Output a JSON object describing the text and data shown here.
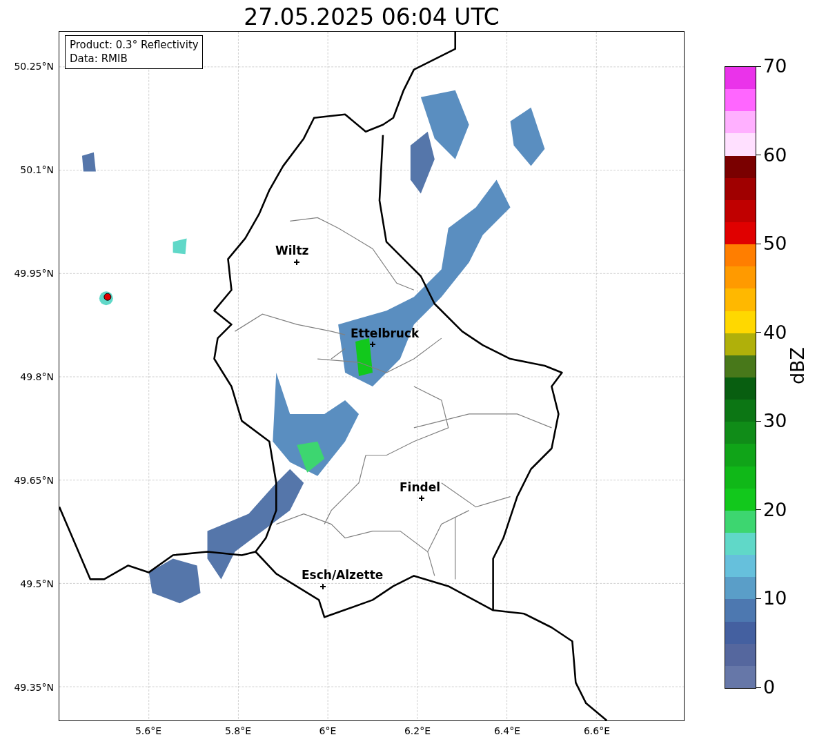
{
  "title": "27.05.2025 06:04 UTC",
  "info_box": [
    "Product: 0.3° Reflectivity",
    "Data: RMIB"
  ],
  "cities": [
    {
      "name": "Wiltz"
    },
    {
      "name": "Ettelbruck"
    },
    {
      "name": "Findel"
    },
    {
      "name": "Esch/Alzette"
    }
  ],
  "y_axis": {
    "ticks": [
      "50.25°N",
      "50.1°N",
      "49.95°N",
      "49.8°N",
      "49.65°N",
      "49.5°N",
      "49.35°N"
    ]
  },
  "x_axis": {
    "ticks": [
      "5.6°E",
      "5.8°E",
      "6°E",
      "6.2°E",
      "6.4°E",
      "6.6°E"
    ]
  },
  "colorbar": {
    "label": "dBZ",
    "ticks": [
      "70",
      "60",
      "50",
      "40",
      "30",
      "20",
      "10",
      "0"
    ],
    "bins": [
      {
        "color": "#ea33ea"
      },
      {
        "color": "#ff66ff"
      },
      {
        "color": "#ffb0ff"
      },
      {
        "color": "#ffe0ff"
      },
      {
        "color": "#7a0000"
      },
      {
        "color": "#a00000"
      },
      {
        "color": "#c00000"
      },
      {
        "color": "#e00000"
      },
      {
        "color": "#ff7e00"
      },
      {
        "color": "#ff9a00"
      },
      {
        "color": "#ffb800"
      },
      {
        "color": "#ffd800"
      },
      {
        "color": "#b0b00a"
      },
      {
        "color": "#48781a"
      },
      {
        "color": "#085e10"
      },
      {
        "color": "#0c7614"
      },
      {
        "color": "#108c18"
      },
      {
        "color": "#10a418"
      },
      {
        "color": "#10b818"
      },
      {
        "color": "#12c81c"
      },
      {
        "color": "#3dd670"
      },
      {
        "color": "#60d8c8"
      },
      {
        "color": "#66c0dc"
      },
      {
        "color": "#5a9ec8"
      },
      {
        "color": "#4d78b0"
      },
      {
        "color": "#4460a0"
      },
      {
        "color": "#55679e"
      },
      {
        "color": "#6677a8"
      }
    ]
  }
}
